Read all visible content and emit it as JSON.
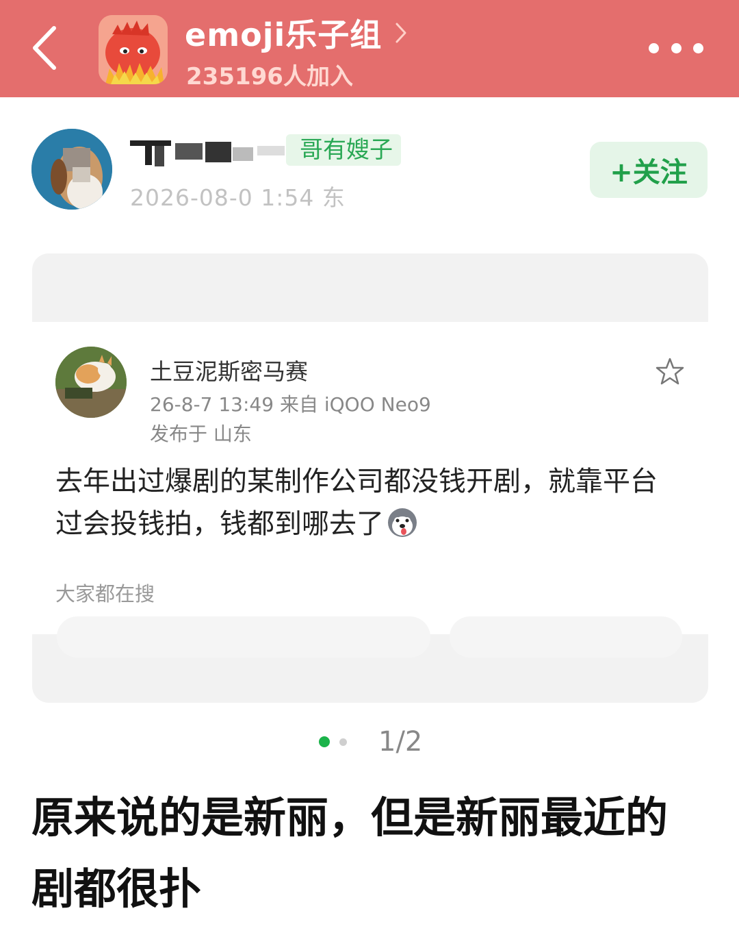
{
  "header": {
    "group_name": "emoji乐子组",
    "members": "235196人加入",
    "background_color": "#e46e6d"
  },
  "author": {
    "tag": "哥有嫂子",
    "meta": "2026-08-0 1:54  东",
    "follow_label": "+关注"
  },
  "embedded_post": {
    "username": "土豆泥斯密马赛",
    "time_source": "26-8-7 13:49  来自 iQOO Neo9",
    "location": "发布于 山东",
    "body": "去年出过爆剧的某制作公司都没钱开剧，就靠平台过会投钱拍，钱都到哪去了",
    "search_label": "大家都在搜"
  },
  "pager": {
    "current": "1/2"
  },
  "caption": "原来说的是新丽，但是新丽最近的剧都很扑",
  "colors": {
    "accent_green": "#21a04a",
    "header_red": "#e46e6d"
  }
}
